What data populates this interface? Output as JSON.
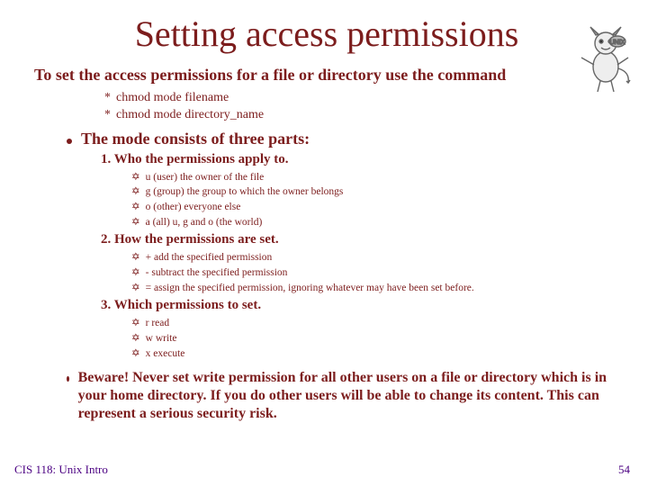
{
  "title": "Setting access permissions",
  "subtitle": "To set the access permissions for a file or directory use the command",
  "commands": {
    "c0": "chmod mode filename",
    "c1": "chmod mode directory_name"
  },
  "mode_heading": "The mode consists of three parts:",
  "sections": {
    "s1": {
      "heading": "1. Who the permissions apply to.",
      "i0": "u  (user)   the owner of the file",
      "i1": "g  (group)  the group to which the owner belongs",
      "i2": "o  (other)  everyone else",
      "i3": "a  (all)     u, g and o (the world)"
    },
    "s2": {
      "heading": "2. How the permissions are set.",
      "i0": "+   add the specified permission",
      "i1": "-   subtract the specified permission",
      "i2": "=   assign the specified permission, ignoring whatever may have been set before."
    },
    "s3": {
      "heading": "3. Which permissions to set.",
      "i0": "r  read",
      "i1": "w write",
      "i2": "x execute"
    }
  },
  "beware": "Beware!  Never set write permission for all other users on a file or directory which is in your home directory. If you do other users will be able to change its content. This can represent a serious security risk.",
  "footer": {
    "left": "CIS 118: Unix Intro",
    "right": "54"
  }
}
